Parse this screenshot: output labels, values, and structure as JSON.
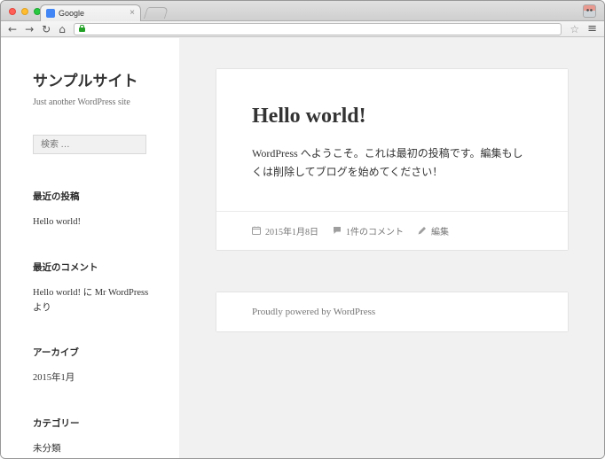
{
  "browser": {
    "tab": {
      "title": "Google"
    },
    "url": "",
    "icons": {
      "tab_close": "×",
      "back": "←",
      "forward": "→",
      "reload": "↻",
      "home": "⌂",
      "bookmark_star": "☆",
      "menu": "≡"
    }
  },
  "sidebar": {
    "site_title": "サンプルサイト",
    "tagline": "Just another WordPress site",
    "search": {
      "placeholder": "検索 …"
    },
    "recent_posts": {
      "title": "最近の投稿",
      "items": [
        "Hello world!"
      ]
    },
    "recent_comments": {
      "title": "最近のコメント",
      "comment": {
        "post_link": "Hello world!",
        "connector": " に ",
        "author_link": "Mr WordPress",
        "suffix": " より"
      }
    },
    "archives": {
      "title": "アーカイブ",
      "items": [
        "2015年1月"
      ]
    },
    "categories": {
      "title": "カテゴリー",
      "items": [
        "未分類"
      ]
    }
  },
  "main": {
    "post": {
      "title": "Hello world!",
      "body": "WordPress へようこそ。これは最初の投稿です。編集もしくは削除してブログを始めてください！",
      "meta": {
        "date": "2015年1月8日",
        "comments": "1件のコメント",
        "edit": "編集"
      }
    },
    "footer": {
      "text": "Proudly powered by ",
      "link": "WordPress"
    }
  },
  "colors": {
    "window_close": "#ff5f57",
    "window_minimize": "#febc2e",
    "window_zoom": "#28c840",
    "ssl_lock": "#23a127",
    "content_background": "#f1f1f1"
  }
}
